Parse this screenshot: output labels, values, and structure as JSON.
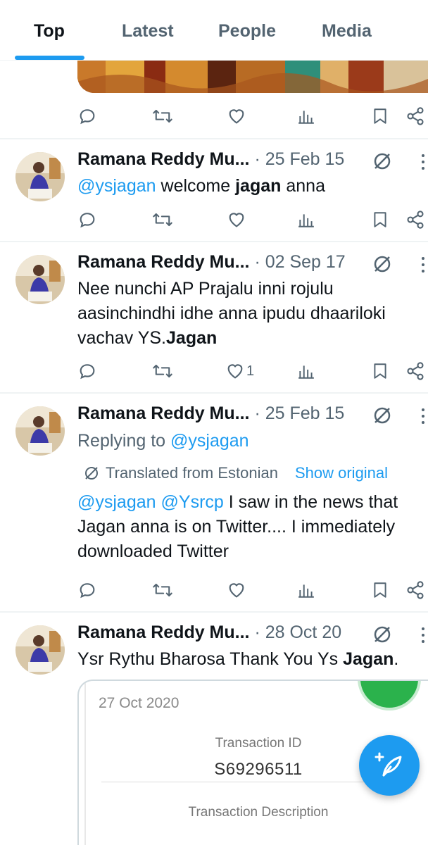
{
  "tabs": [
    {
      "label": "Top",
      "active": true
    },
    {
      "label": "Latest",
      "active": false
    },
    {
      "label": "People",
      "active": false
    },
    {
      "label": "Media",
      "active": false
    }
  ],
  "icons": {
    "reply": "reply-icon",
    "retweet": "retweet-icon",
    "like": "heart-icon",
    "views": "views-icon",
    "bookmark": "bookmark-icon",
    "share": "share-icon",
    "more": "more-icon",
    "translate": "translate-icon",
    "compose": "compose-icon"
  },
  "colors": {
    "accent": "#1d9bf0",
    "secondary_text": "#536471",
    "primary_text": "#0f1419",
    "green": "#2bb24c"
  },
  "tweets": [
    {
      "author": "Ramana Reddy Mu...",
      "date": "· 25 Feb 15",
      "mention": "@ysjagan",
      "text_mid": " welcome ",
      "text_bold": "jagan",
      "text_end": " anna"
    },
    {
      "author": "Ramana Reddy Mu...",
      "date": "· 02 Sep 17",
      "line1": "Nee nunchi AP Prajalu inni rojulu",
      "line2": "aasinchindhi idhe anna ipudu dhaariloki",
      "line3_start": "vachav YS.",
      "line3_bold": "Jagan",
      "like_count": "1"
    },
    {
      "author": "Ramana Reddy Mu...",
      "date": "· 25 Feb 15",
      "replying_label": "Replying to ",
      "replying_handle": "@ysjagan",
      "translated_label": "Translated from Estonian",
      "show_original": "Show original",
      "mention1": "@ysjagan",
      "mention2": "@Ysrcp",
      "line1_rest": " I saw in the news that",
      "line2": "Jagan anna is on Twitter.... I immediately",
      "line3": "downloaded Twitter"
    },
    {
      "author": "Ramana Reddy Mu...",
      "date": "· 28 Oct 20",
      "text_start": "Ysr Rythu Bharosa Thank You Ys ",
      "text_bold": "Jagan",
      "text_end": ".",
      "card": {
        "date": "27 Oct 2020",
        "txn_label": "Transaction ID",
        "txn_value": "S69296511",
        "desc_label": "Transaction Description"
      }
    }
  ]
}
